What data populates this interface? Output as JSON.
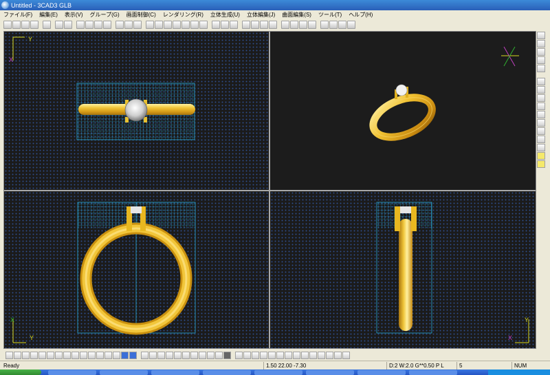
{
  "window": {
    "title": "Untitled - 3CAD3 GLB"
  },
  "menu": [
    "ファイル(F)",
    "編集(E)",
    "表示(V)",
    "グループ(G)",
    "画面制御(C)",
    "レンダリング(R)",
    "立体生成(U)",
    "立体編集(J)",
    "曲面編集(S)",
    "ツール(T)",
    "ヘルプ(H)"
  ],
  "viewports": {
    "top": {
      "axis_y": "Y",
      "axis_x": "X"
    },
    "front": {
      "axis_y": "Y",
      "axis_x": "X"
    },
    "side": {
      "axis_y": "Y",
      "axis_x": "X"
    }
  },
  "status": {
    "ready": "Ready",
    "coords": "1.50 22.00 -7.30",
    "params": "D:2 W:2.0 G**0.50 P   L",
    "layer": "5",
    "num": "NUM"
  },
  "colors": {
    "gold": "#e8b820",
    "grid_cyan": "#29a8d8",
    "viewport_bg": "#1b1b1b",
    "axis_yellow": "#d8d820",
    "axis_magenta": "#c040c0",
    "axis_green": "#30b030"
  }
}
